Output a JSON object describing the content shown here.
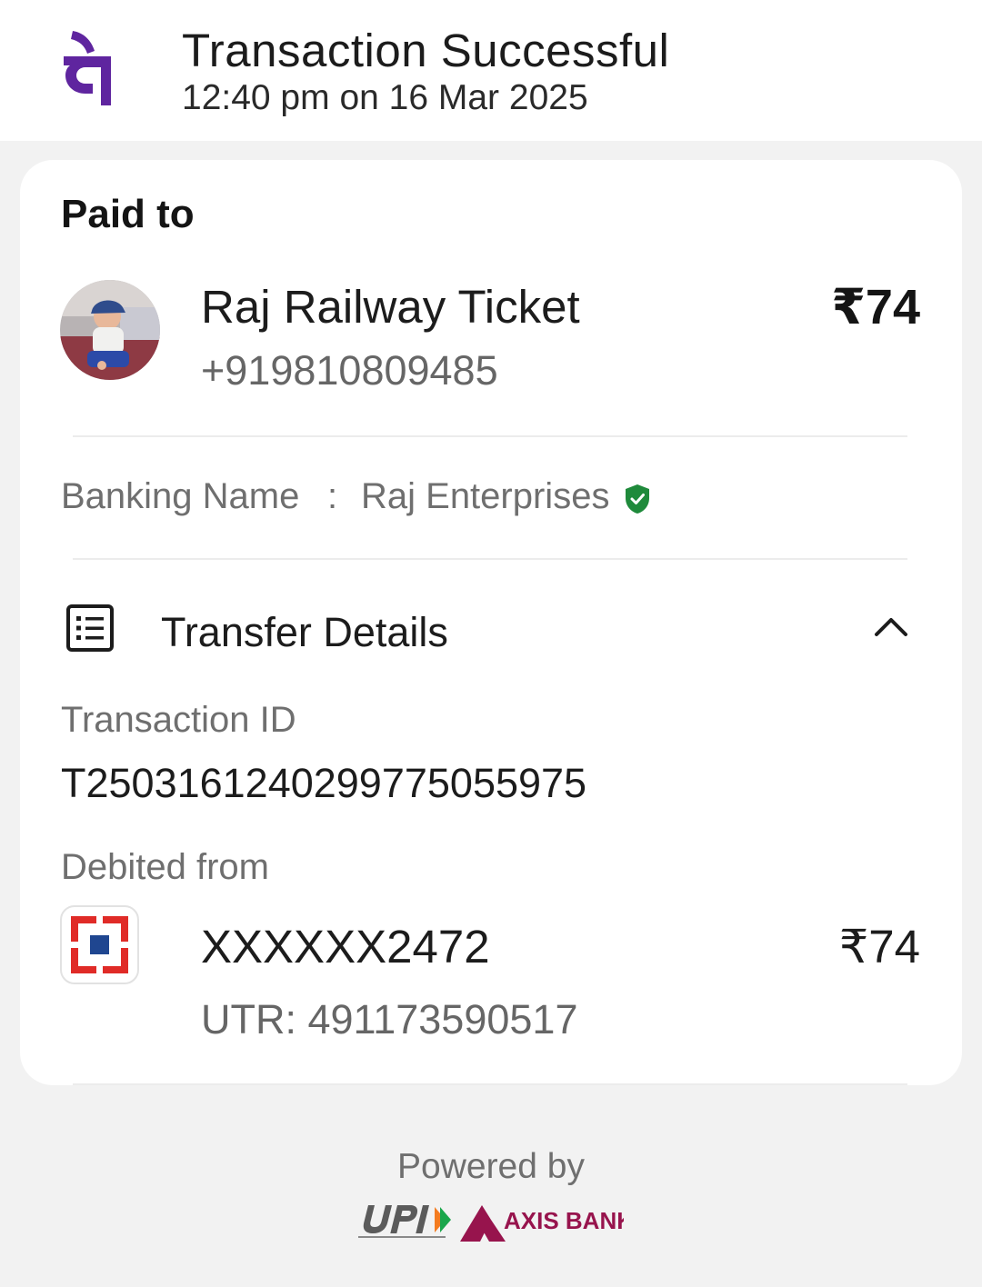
{
  "header": {
    "title": "Transaction Successful",
    "datetime": "12:40 pm on 16 Mar 2025",
    "logo_icon": "phonepe-logo-icon",
    "brand_color": "#5f259f"
  },
  "payee": {
    "section_label": "Paid to",
    "name": "Raj Railway Ticket",
    "phone": "+919810809485",
    "amount": "₹74",
    "avatar_icon": "profile-photo-avatar"
  },
  "banking": {
    "label": "Banking Name",
    "separator": ":",
    "value": "Raj Enterprises",
    "verified_icon": "verified-shield-icon",
    "verified_color": "#1f8a3b"
  },
  "transfer_details": {
    "title": "Transfer Details",
    "icon": "receipt-list-icon",
    "toggle_icon": "chevron-up-icon",
    "transaction_id_label": "Transaction ID",
    "transaction_id": "T2503161240299775055975",
    "debited_from_label": "Debited from",
    "account": "XXXXXX2472",
    "account_amount": "₹74",
    "utr": "UTR: 491173590517",
    "bank_icon": "hdfc-bank-logo-icon",
    "bank_color": "#e02b27"
  },
  "footer": {
    "powered_by": "Powered by",
    "upi_logo": "upi-logo",
    "partner_bank": "AXIS BANK",
    "partner_color": "#97144d"
  }
}
